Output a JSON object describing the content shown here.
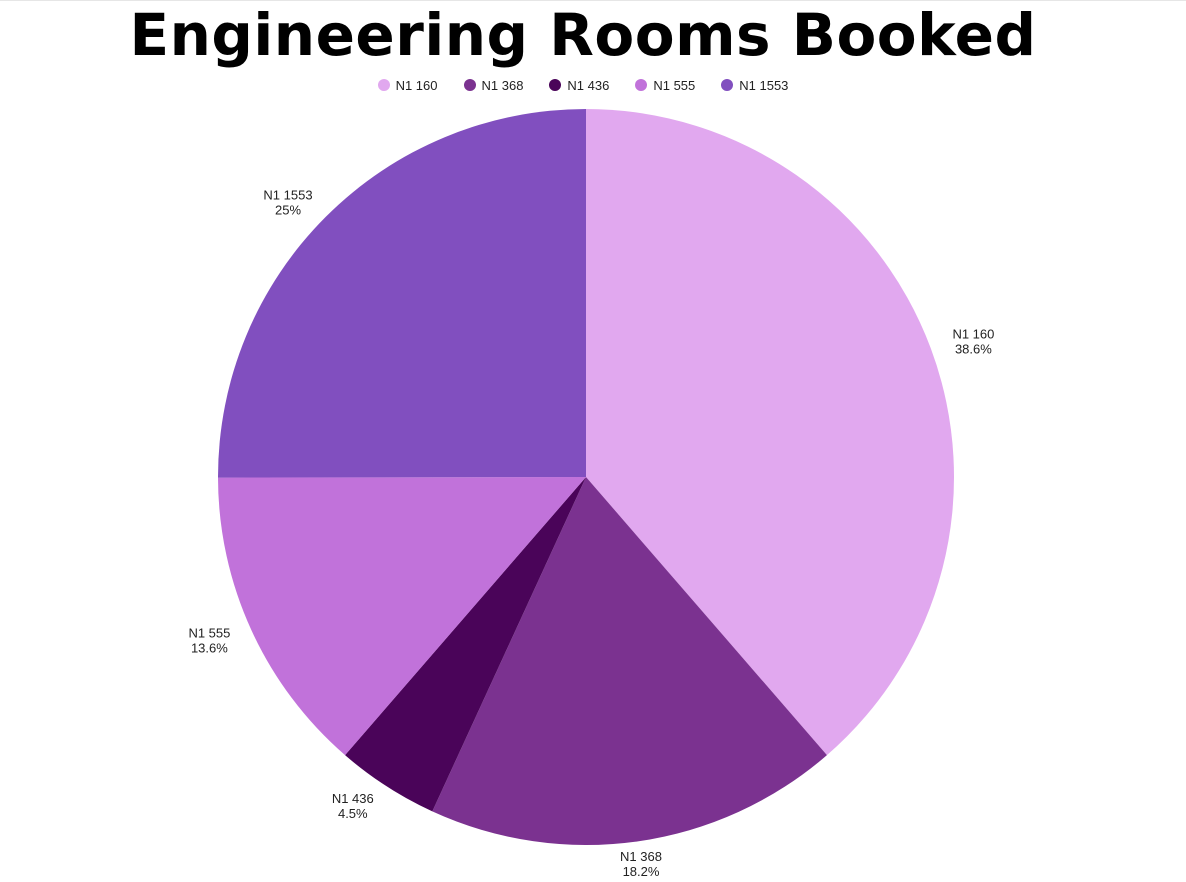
{
  "chart_data": {
    "type": "pie",
    "title": "Engineering Rooms Booked",
    "legend_position": "top",
    "slices": [
      {
        "label": "N1 160",
        "value": 38.6,
        "value_label": "38.6%",
        "color": "#e1a8ef"
      },
      {
        "label": "N1 368",
        "value": 18.2,
        "value_label": "18.2%",
        "color": "#7b3290"
      },
      {
        "label": "N1 436",
        "value": 4.5,
        "value_label": "4.5%",
        "color": "#4a0459"
      },
      {
        "label": "N1 555",
        "value": 13.6,
        "value_label": "13.6%",
        "color": "#c172da"
      },
      {
        "label": "N1 1553",
        "value": 25,
        "value_label": "25%",
        "color": "#814fbf"
      }
    ]
  }
}
